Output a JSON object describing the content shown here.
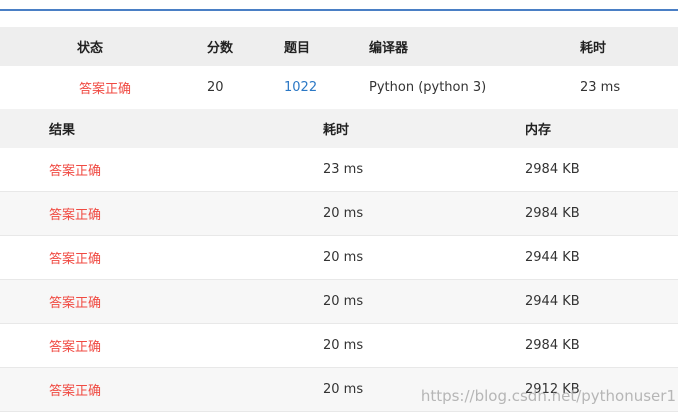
{
  "summary": {
    "headers": {
      "status": "状态",
      "score": "分数",
      "problem": "题目",
      "compiler": "编译器",
      "time": "耗时"
    },
    "row": {
      "status": "答案正确",
      "score": "20",
      "problem": "1022",
      "compiler": "Python (python 3)",
      "time": "23 ms"
    }
  },
  "details": {
    "headers": {
      "result": "结果",
      "time": "耗时",
      "memory": "内存"
    },
    "rows": [
      {
        "result": "答案正确",
        "time": "23 ms",
        "memory": "2984 KB"
      },
      {
        "result": "答案正确",
        "time": "20 ms",
        "memory": "2984 KB"
      },
      {
        "result": "答案正确",
        "time": "20 ms",
        "memory": "2944 KB"
      },
      {
        "result": "答案正确",
        "time": "20 ms",
        "memory": "2944 KB"
      },
      {
        "result": "答案正确",
        "time": "20 ms",
        "memory": "2984 KB"
      },
      {
        "result": "答案正确",
        "time": "20 ms",
        "memory": "2912 KB"
      }
    ]
  },
  "watermark": "https://blog.csdn.net/pythonuser1",
  "colors": {
    "accent_line": "#4a7fc5",
    "correct": "#f04a42",
    "link": "#2b78c5"
  }
}
